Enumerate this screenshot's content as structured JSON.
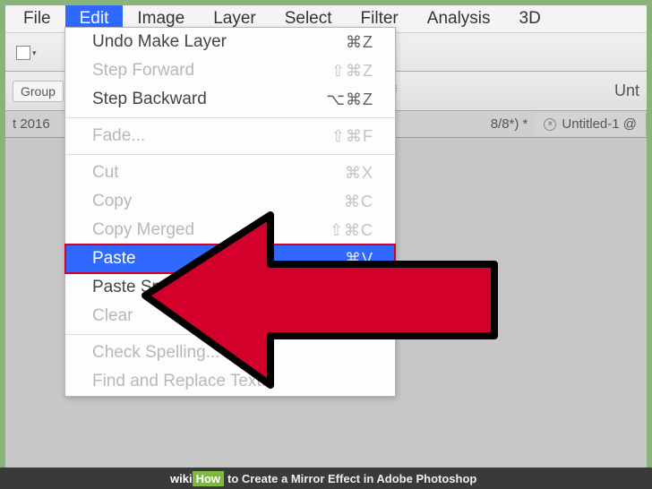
{
  "menubar": {
    "items": [
      {
        "label": "File"
      },
      {
        "label": "Edit",
        "active": true
      },
      {
        "label": "Image"
      },
      {
        "label": "Layer"
      },
      {
        "label": "Select"
      },
      {
        "label": "Filter"
      },
      {
        "label": "Analysis"
      },
      {
        "label": "3D"
      }
    ]
  },
  "toolbar": {
    "group_label": "Group",
    "unit_label": "Unt"
  },
  "tabs": {
    "left_partial": "t 2016",
    "right_partial": "8/8*) *",
    "untitled": "Untitled-1 @"
  },
  "edit_menu": {
    "items": [
      {
        "label": "Undo Make Layer",
        "shortcut": "⌘Z",
        "disabled": false
      },
      {
        "label": "Step Forward",
        "shortcut": "⇧⌘Z",
        "disabled": true
      },
      {
        "label": "Step Backward",
        "shortcut": "⌥⌘Z",
        "disabled": false
      },
      {
        "sep": true
      },
      {
        "label": "Fade...",
        "shortcut": "⇧⌘F",
        "disabled": true
      },
      {
        "sep": true
      },
      {
        "label": "Cut",
        "shortcut": "⌘X",
        "disabled": true
      },
      {
        "label": "Copy",
        "shortcut": "⌘C",
        "disabled": true
      },
      {
        "label": "Copy Merged",
        "shortcut": "⇧⌘C",
        "disabled": true
      },
      {
        "label": "Paste",
        "shortcut": "⌘V",
        "disabled": false,
        "highlight": true
      },
      {
        "label": "Paste Special",
        "shortcut": "",
        "disabled": false
      },
      {
        "label": "Clear",
        "shortcut": "",
        "disabled": true
      },
      {
        "sep": true
      },
      {
        "label": "Check Spelling...",
        "shortcut": "",
        "disabled": true
      },
      {
        "label": "Find and Replace Text...",
        "shortcut": "",
        "disabled": true
      }
    ]
  },
  "caption": {
    "wiki": "wiki",
    "how": "How",
    "title": "to Create a Mirror Effect in Adobe Photoshop"
  }
}
